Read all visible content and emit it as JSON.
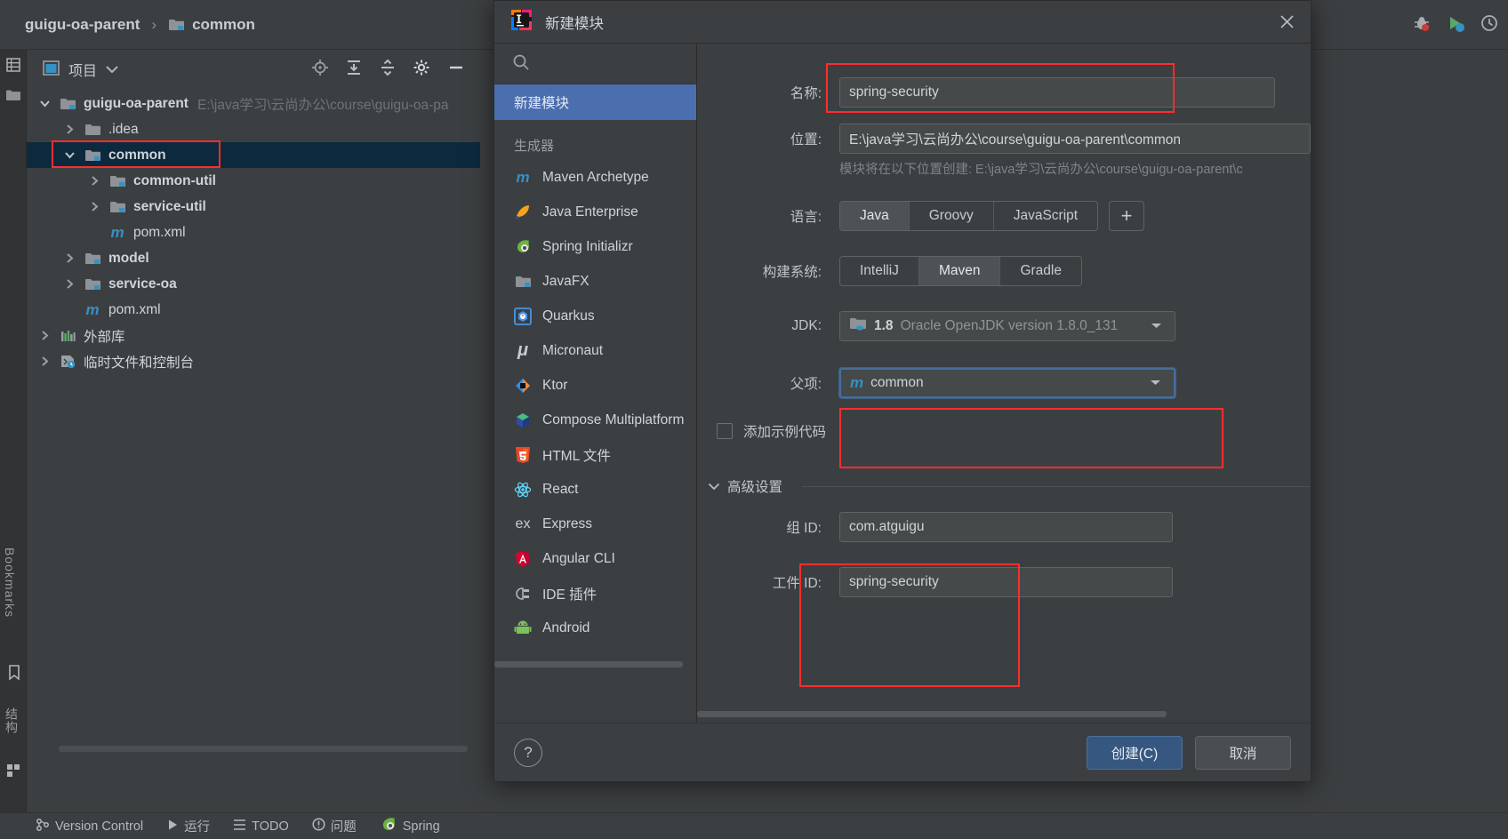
{
  "ide": {
    "breadcrumb": {
      "root": "guigu-oa-parent",
      "separator": "›",
      "current": "common"
    },
    "left_strip": {
      "top_tool": "structure-grid-icon",
      "folder_tool": "folder-icon",
      "bookmarks_label": "Bookmarks",
      "structure_label": "结构"
    },
    "project_panel": {
      "title": "项目",
      "icons": [
        "locate-icon",
        "expand-all-icon",
        "collapse-all-icon",
        "settings-gear-icon",
        "hide-icon"
      ],
      "tree": [
        {
          "label": "guigu-oa-parent",
          "path": "E:\\java学习\\云尚办公\\course\\guigu-oa-pa",
          "indent": 0,
          "arrow": "down",
          "icon": "module-folder-icon",
          "bold": true,
          "selected": false
        },
        {
          "label": ".idea",
          "path": "",
          "indent": 1,
          "arrow": "right",
          "icon": "folder-icon",
          "bold": false,
          "selected": false
        },
        {
          "label": "common",
          "path": "",
          "indent": 1,
          "arrow": "down",
          "icon": "module-folder-icon",
          "bold": true,
          "selected": true
        },
        {
          "label": "common-util",
          "path": "",
          "indent": 2,
          "arrow": "right",
          "icon": "module-folder-icon",
          "bold": true,
          "selected": false
        },
        {
          "label": "service-util",
          "path": "",
          "indent": 2,
          "arrow": "right",
          "icon": "module-folder-icon",
          "bold": true,
          "selected": false
        },
        {
          "label": "pom.xml",
          "path": "",
          "indent": 2,
          "arrow": "none",
          "icon": "maven-m-icon",
          "bold": false,
          "selected": false
        },
        {
          "label": "model",
          "path": "",
          "indent": 1,
          "arrow": "right",
          "icon": "module-folder-icon",
          "bold": true,
          "selected": false
        },
        {
          "label": "service-oa",
          "path": "",
          "indent": 1,
          "arrow": "right",
          "icon": "module-folder-icon",
          "bold": true,
          "selected": false
        },
        {
          "label": "pom.xml",
          "path": "",
          "indent": 1,
          "arrow": "none",
          "icon": "maven-m-icon",
          "bold": false,
          "selected": false
        },
        {
          "label": "外部库",
          "path": "",
          "indent": 0,
          "arrow": "right",
          "icon": "external-libraries-icon",
          "bold": false,
          "selected": false
        },
        {
          "label": "临时文件和控制台",
          "path": "",
          "indent": 0,
          "arrow": "right",
          "icon": "scratches-icon",
          "bold": false,
          "selected": false
        }
      ]
    },
    "right_icons": [
      "debug-bug-icon",
      "run-with-coverage-icon",
      "notifications-icon"
    ],
    "status_bar": [
      {
        "icon": "version-control-icon",
        "label": "Version Control"
      },
      {
        "icon": "run-play-icon",
        "label": "运行"
      },
      {
        "icon": "todo-icon",
        "label": "TODO"
      },
      {
        "icon": "problems-icon",
        "label": "问题"
      },
      {
        "icon": "spring-leaf-icon",
        "label": "Spring"
      }
    ]
  },
  "dialog": {
    "title": "新建模块",
    "app_icon": "intellij-idea-icon",
    "close_icon": "close-icon",
    "search": {
      "icon": "search-icon",
      "placeholder": ""
    },
    "selected_generator": "新建模块",
    "generators_section_label": "生成器",
    "generators": [
      {
        "label": "Maven Archetype",
        "icon": "maven-m-icon"
      },
      {
        "label": "Java Enterprise",
        "icon": "java-enterprise-icon"
      },
      {
        "label": "Spring Initializr",
        "icon": "spring-leaf-icon"
      },
      {
        "label": "JavaFX",
        "icon": "javafx-folder-icon"
      },
      {
        "label": "Quarkus",
        "icon": "quarkus-icon"
      },
      {
        "label": "Micronaut",
        "icon": "micronaut-mu-icon"
      },
      {
        "label": "Ktor",
        "icon": "ktor-icon"
      },
      {
        "label": "Compose Multiplatform",
        "icon": "compose-cube-icon"
      },
      {
        "label": "HTML 文件",
        "icon": "html5-icon"
      },
      {
        "label": "React",
        "icon": "react-atom-icon"
      },
      {
        "label": "Express",
        "icon": "express-ex-icon"
      },
      {
        "label": "Angular CLI",
        "icon": "angular-shield-icon"
      },
      {
        "label": "IDE 插件",
        "icon": "plugin-plug-icon"
      },
      {
        "label": "Android",
        "icon": "android-robot-icon"
      }
    ],
    "form": {
      "name_label": "名称:",
      "name_value": "spring-security",
      "location_label": "位置:",
      "location_value": "E:\\java学习\\云尚办公\\course\\guigu-oa-parent\\common",
      "location_hint": "模块将在以下位置创建: E:\\java学习\\云尚办公\\course\\guigu-oa-parent\\c",
      "language_label": "语言:",
      "language_options": [
        "Java",
        "Groovy",
        "JavaScript"
      ],
      "language_selected": "Java",
      "add_language_label": "+",
      "build_system_label": "构建系统:",
      "build_system_options": [
        "IntelliJ",
        "Maven",
        "Gradle"
      ],
      "build_system_selected": "Maven",
      "jdk_label": "JDK:",
      "jdk_value_bold": "1.8",
      "jdk_value_rest": "Oracle OpenJDK version 1.8.0_131",
      "jdk_icon": "jdk-folder-icon",
      "parent_label": "父项:",
      "parent_value": "common",
      "parent_icon": "maven-m-icon",
      "sample_code_label": "添加示例代码",
      "sample_code_checked": false,
      "advanced_label": "高级设置",
      "advanced_expanded": true,
      "group_id_label": "组 ID:",
      "group_id_value": "com.atguigu",
      "artifact_id_label": "工件 ID:",
      "artifact_id_value": "spring-security"
    },
    "footer": {
      "help_label": "?",
      "create_label": "创建(C)",
      "cancel_label": "取消"
    }
  },
  "colors": {
    "accent_blue": "#4b6eaf",
    "primary_button": "#365880",
    "highlight_red": "#ff2d2d",
    "selected_row": "#0d293e",
    "panel_bg": "#3c3f41"
  }
}
